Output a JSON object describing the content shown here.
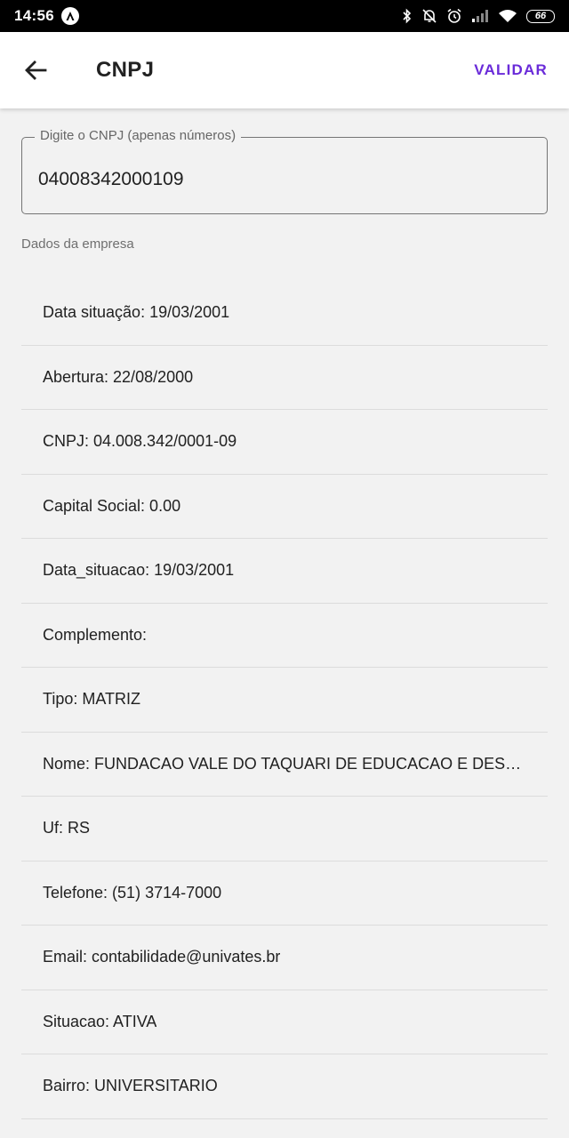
{
  "status_bar": {
    "time": "14:56",
    "battery": "66",
    "icons": [
      "bluetooth-icon",
      "notifications-off-icon",
      "alarm-icon",
      "signal-icon",
      "wifi-icon",
      "battery-icon"
    ]
  },
  "app_bar": {
    "title": "CNPJ",
    "action_label": "VALIDAR",
    "accent_color": "#6a2bd9"
  },
  "cnpj_field": {
    "label": "Digite o CNPJ (apenas números)",
    "value": "04008342000109"
  },
  "section": {
    "title": "Dados da empresa"
  },
  "company_items": [
    "Data situação: 19/03/2001",
    "Abertura: 22/08/2000",
    "CNPJ: 04.008.342/0001-09",
    "Capital Social: 0.00",
    "Data_situacao: 19/03/2001",
    "Complemento:",
    "Tipo: MATRIZ",
    "Nome: FUNDACAO VALE DO TAQUARI DE EDUCACAO E DESEN…",
    "Uf: RS",
    "Telefone: (51) 3714-7000",
    "Email: contabilidade@univates.br",
    "Situacao: ATIVA",
    "Bairro: UNIVERSITARIO"
  ]
}
